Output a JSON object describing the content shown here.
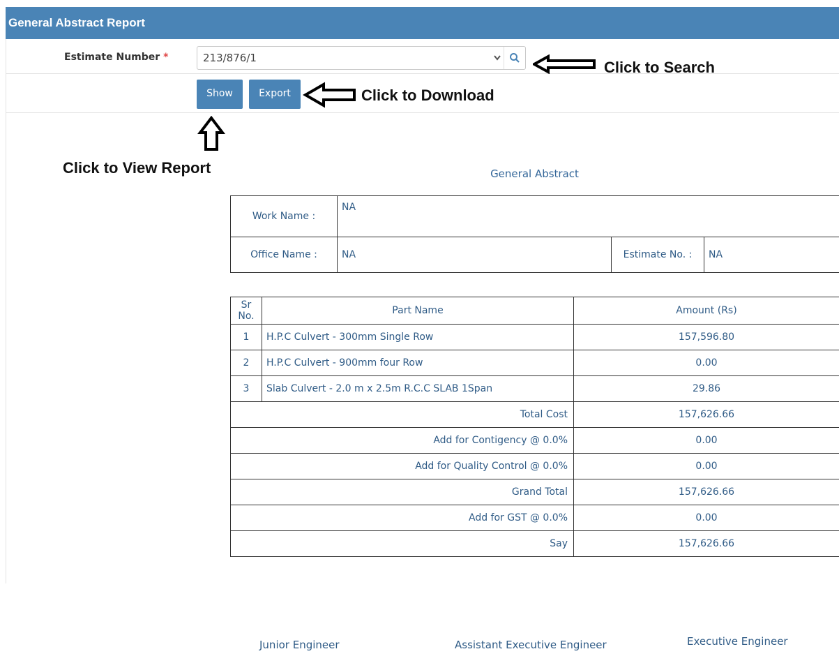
{
  "header": {
    "title": "General Abstract Report"
  },
  "form": {
    "estimate_label": "Estimate Number",
    "required_mark": "*",
    "estimate_value": "213/876/1",
    "show_label": "Show",
    "export_label": "Export"
  },
  "annotations": {
    "search": "Click to Search",
    "download": "Click to Download",
    "view": "Click to View Report"
  },
  "report": {
    "title": "General Abstract",
    "work_name_label": "Work Name :",
    "work_name_value": "NA",
    "office_name_label": "Office Name :",
    "office_name_value": "NA",
    "estimate_no_label": "Estimate No. :",
    "estimate_no_value": "NA",
    "columns": [
      "Sr No.",
      "Part Name",
      "Amount (Rs)"
    ],
    "rows": [
      {
        "sr": "1",
        "name": "H.P.C Culvert - 300mm Single Row",
        "amount": "157,596.80"
      },
      {
        "sr": "2",
        "name": "H.P.C Culvert - 900mm four Row",
        "amount": "0.00"
      },
      {
        "sr": "3",
        "name": "Slab Culvert - 2.0 m x 2.5m R.C.C SLAB 1Span",
        "amount": "29.86"
      }
    ],
    "summary": [
      {
        "label": "Total Cost",
        "amount": "157,626.66"
      },
      {
        "label": "Add for Contigency @ 0.0%",
        "amount": "0.00"
      },
      {
        "label": "Add for Quality Control @ 0.0%",
        "amount": "0.00"
      },
      {
        "label": "Grand Total",
        "amount": "157,626.66"
      },
      {
        "label": "Add for GST @ 0.0%",
        "amount": "0.00"
      },
      {
        "label": "Say",
        "amount": "157,626.66"
      }
    ]
  },
  "signatures": {
    "junior": "Junior Engineer",
    "assistant": "Assistant Executive Engineer",
    "executive": "Executive Engineer"
  },
  "icons": {
    "search": "search-icon",
    "dropdown": "chevron-down-icon"
  },
  "colors": {
    "header": "#4a84b6",
    "button": "#4a84b6",
    "text_blue": "#2f5b86",
    "required": "#e04848"
  }
}
